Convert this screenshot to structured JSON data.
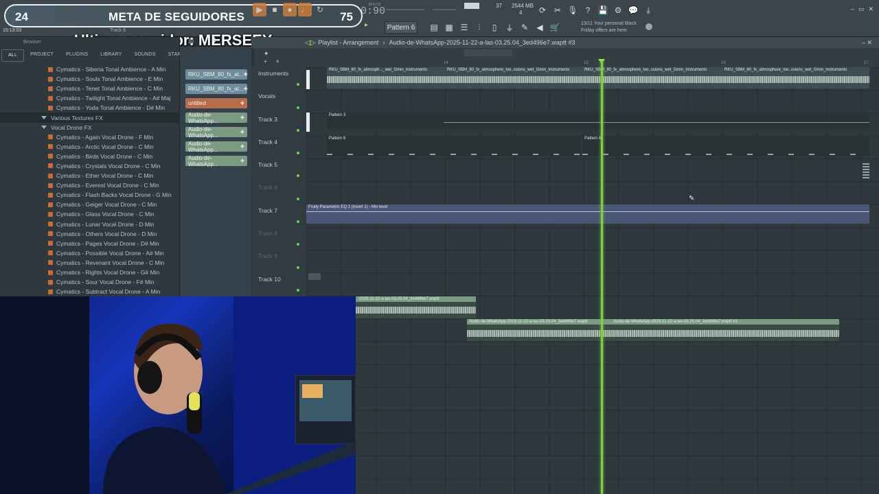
{
  "overlay": {
    "goal_current": "24",
    "goal_title": "META DE SEGUIDORES",
    "goal_target": "75",
    "last_follower": "Ultimo seguidor: MERSEEY",
    "clock": "15:13:03"
  },
  "toolbar": {
    "tempo": "0:40:90",
    "time_unit": "M:S:CS",
    "pattern": "Pattern 6",
    "cpu": "37",
    "memory": "2544 MB",
    "voices": "4",
    "promo_line1": "13/11 Your personal Black",
    "promo_line2": "Friday offers are here",
    "track_label": "Track 6"
  },
  "browser": {
    "title": "Browser",
    "tabs": [
      "ALL",
      "PROJECT",
      "PLUGINS",
      "LIBRARY",
      "SOUNDS",
      "STARRED"
    ],
    "items": [
      {
        "type": "file",
        "label": "Cymatics - Siberia Tonal Ambience - A Min"
      },
      {
        "type": "file",
        "label": "Cymatics - Souls Tonal Ambience - E Min"
      },
      {
        "type": "file",
        "label": "Cymatics - Tenet Tonal Ambience - C Min"
      },
      {
        "type": "file",
        "label": "Cymatics - Twilight Tonal Ambience - A# Maj"
      },
      {
        "type": "file",
        "label": "Cymatics - Yoda Tonal Ambience - D# Min"
      },
      {
        "type": "folder",
        "label": "Various Textures FX"
      },
      {
        "type": "folder",
        "label": "Vocal Drone FX"
      },
      {
        "type": "file",
        "label": "Cymatics - Again Vocal Drone - F Min"
      },
      {
        "type": "file",
        "label": "Cymatics - Arctic Vocal Drone - C Min"
      },
      {
        "type": "file",
        "label": "Cymatics - Birds Vocal Drone - C Min"
      },
      {
        "type": "file",
        "label": "Cymatics - Crystals Vocal Drone - C Min"
      },
      {
        "type": "file",
        "label": "Cymatics - Ether Vocal Drone - C Min"
      },
      {
        "type": "file",
        "label": "Cymatics - Everest Vocal Drone - C Min"
      },
      {
        "type": "file",
        "label": "Cymatics - Flash Backs Vocal Drone - G Min"
      },
      {
        "type": "file",
        "label": "Cymatics - Geiger Vocal Drone - C Min"
      },
      {
        "type": "file",
        "label": "Cymatics - Glass Vocal Drone - C Min"
      },
      {
        "type": "file",
        "label": "Cymatics - Lunar Vocal Drone - D Min"
      },
      {
        "type": "file",
        "label": "Cymatics - Others Vocal Drone - D Min"
      },
      {
        "type": "file",
        "label": "Cymatics - Pages Vocal Drone - D# Min"
      },
      {
        "type": "file",
        "label": "Cymatics - Possible Vocal Drone - A# Min"
      },
      {
        "type": "file",
        "label": "Cymatics - Revenant Vocal Drone - C Min"
      },
      {
        "type": "file",
        "label": "Cymatics - Rights Vocal Drone - G# Min"
      },
      {
        "type": "file",
        "label": "Cymatics - Sour Vocal Drone - F# Min"
      },
      {
        "type": "file",
        "label": "Cymatics - Subtract Vocal Drone - A Min"
      }
    ]
  },
  "channels": [
    {
      "label": "RKU_SBM_80_fx_at...",
      "color": "#6e8c99"
    },
    {
      "label": "RKU_SBM_80_fx_at...",
      "color": "#6e8c99"
    },
    {
      "label": "untitled",
      "color": "#b96c4a"
    },
    {
      "label": "Audio-de-WhatsApp...",
      "color": "#7a9a82"
    },
    {
      "label": "Audio-de-WhatsApp...",
      "color": "#7a9a82"
    },
    {
      "label": "Audio-de-WhatsApp...",
      "color": "#7a9a82"
    },
    {
      "label": "Audio-de-WhatsApp...",
      "color": "#7a9a82"
    }
  ],
  "playlist": {
    "title": "Playlist - Arrangement",
    "file": "Audio-de-WhatsApp-2025-11-22-a-las-03.25.04_3ed496e7.waptt #3",
    "ruler": [
      "14",
      "15",
      "16",
      "17"
    ],
    "tracks": [
      {
        "name": "Instruments",
        "dim": false
      },
      {
        "name": "Vocals",
        "dim": false
      },
      {
        "name": "Track 3",
        "dim": false
      },
      {
        "name": "Track 4",
        "dim": false
      },
      {
        "name": "Track 5",
        "dim": false
      },
      {
        "name": "Track 6",
        "dim": true
      },
      {
        "name": "Track 7",
        "dim": false
      },
      {
        "name": "Track 8",
        "dim": true
      },
      {
        "name": "Track 9",
        "dim": true
      },
      {
        "name": "Track 10",
        "dim": false
      }
    ],
    "clips": {
      "instruments_1": "RKU_SBM_80_fx_atmosph..._wet_Gmin_instruments",
      "instruments_2": "RKU_SBM_80_fx_atmosphere_loo..ssions_wet_Gmin_instruments",
      "instruments_3": "RKU_SBM_80_fx_atmosphere_loo..ssions_wet_Gmin_instruments",
      "instruments_4": "RKU_SBM_80_fx_atmosphere_loo..ssions_wet_Gmin_instruments",
      "track3": "Pattern 3",
      "track4a": "Pattern 6",
      "track4b": "Pattern 6",
      "track7": "Fruity Parametric EQ 2 (Insert 1) - Mix level",
      "audio_a": "-2025-11-22-a-las-03.25.04_3ed496e7.waptt",
      "audio_b": "Audio-de-WhatsApp-2025-11-22-a-las-03.25.04_3ed496e7.waptt",
      "audio_c": "Audio-de-WhatsApp-2025-11-22-a-las-03.25.04_3ed496e7.waptt #3"
    }
  }
}
